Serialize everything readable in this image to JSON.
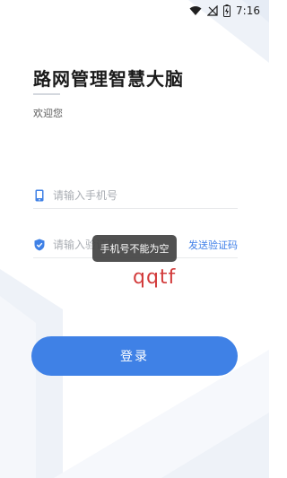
{
  "status_bar": {
    "time": "7:16",
    "icons": [
      "wifi-icon",
      "signal-off-icon",
      "battery-charging-icon"
    ]
  },
  "header": {
    "title": "路网管理智慧大脑",
    "subtitle": "欢迎您"
  },
  "form": {
    "phone": {
      "icon": "phone-icon",
      "placeholder": "请输入手机号",
      "value": ""
    },
    "code": {
      "icon": "shield-check-icon",
      "placeholder": "请输入验证码",
      "value": "",
      "send_code_label": "发送验证码"
    }
  },
  "toast": {
    "message": "手机号不能为空"
  },
  "handwritten_text": "qqtf",
  "login_button": {
    "label": "登录"
  },
  "colors": {
    "accent": "#3f81e6",
    "link": "#3f7fe8",
    "toast_bg": "#424242",
    "handwriting": "#d23a3a"
  }
}
